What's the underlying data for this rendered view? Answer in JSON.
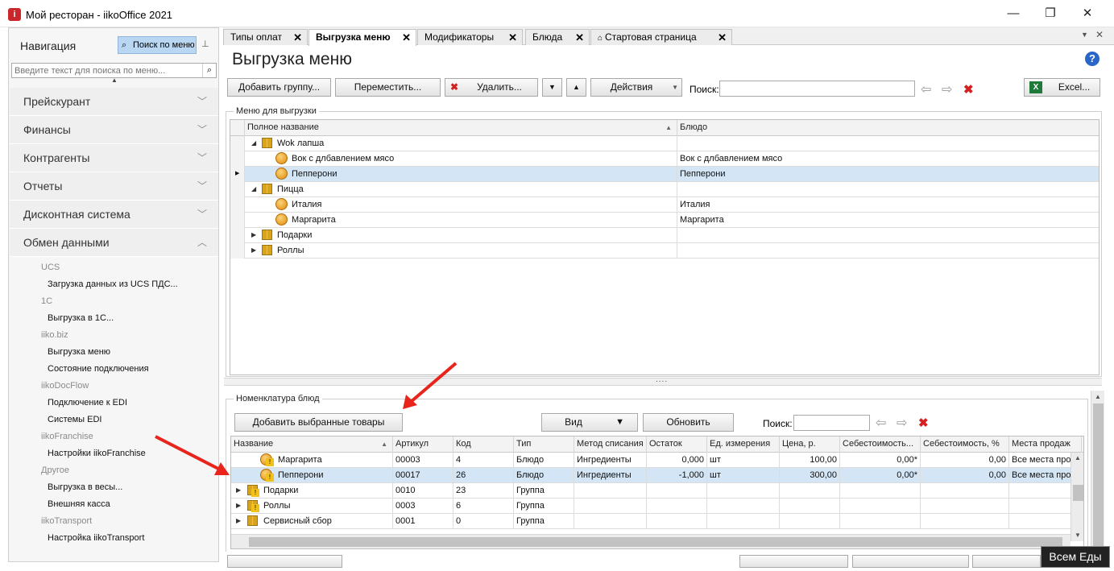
{
  "window": {
    "title": "Мой ресторан - iikoOffice 2021",
    "app_icon": "iiko-app-icon",
    "minimize_glyph": "—",
    "maximize_glyph": "❐",
    "close_glyph": "✕"
  },
  "nav": {
    "title": "Навигация",
    "search_button": "Поиск по меню",
    "search_placeholder": "Введите текст для поиска по меню...",
    "categories": [
      {
        "label": "Прейскурант",
        "expanded": false
      },
      {
        "label": "Финансы",
        "expanded": false
      },
      {
        "label": "Контрагенты",
        "expanded": false
      },
      {
        "label": "Отчеты",
        "expanded": false
      },
      {
        "label": "Дисконтная система",
        "expanded": false
      },
      {
        "label": "Обмен данными",
        "expanded": true
      }
    ],
    "items": [
      {
        "group": "UCS"
      },
      {
        "label": "Загрузка данных из UCS ПДС..."
      },
      {
        "group": "1C"
      },
      {
        "label": "Выгрузка в 1С..."
      },
      {
        "group": "iiko.biz"
      },
      {
        "label": "Выгрузка меню"
      },
      {
        "label": "Состояние подключения"
      },
      {
        "group": "iikoDocFlow"
      },
      {
        "label": "Подключение к EDI"
      },
      {
        "label": "Системы EDI"
      },
      {
        "group": "iikoFranchise"
      },
      {
        "label": "Настройки iikoFranchise"
      },
      {
        "group": "Другое"
      },
      {
        "label": "Выгрузка в весы..."
      },
      {
        "label": "Внешняя касса"
      },
      {
        "group": "iikoTransport"
      },
      {
        "label": "Настройка iikoTransport"
      }
    ]
  },
  "tabs": [
    {
      "label": "Типы оплат",
      "active": false
    },
    {
      "label": "Выгрузка меню",
      "active": true
    },
    {
      "label": "Модификаторы",
      "active": false
    },
    {
      "label": "Блюда",
      "active": false
    },
    {
      "label": "Стартовая страница",
      "active": false
    }
  ],
  "page": {
    "title": "Выгрузка меню"
  },
  "toolbar": {
    "add_group": "Добавить группу...",
    "move": "Переместить...",
    "delete": "Удалить...",
    "actions": "Действия",
    "search_label": "Поиск:",
    "excel": "Excel..."
  },
  "menu_panel": {
    "title": "Меню для выгрузки",
    "columns": [
      "Полное название",
      "Блюдо"
    ],
    "rows": [
      {
        "level": 0,
        "type": "group",
        "expanded": true,
        "name": "Wok лапша",
        "dish": "",
        "selected": false
      },
      {
        "level": 1,
        "type": "dish",
        "name": "Вок с длбавлением мясо",
        "dish": "Вок с длбавлением мясо",
        "selected": false
      },
      {
        "level": 1,
        "type": "dish",
        "name": "Пепперони",
        "dish": "Пепперони",
        "selected": true
      },
      {
        "level": 0,
        "type": "group",
        "expanded": true,
        "name": "Пицца",
        "dish": "",
        "selected": false
      },
      {
        "level": 1,
        "type": "dish",
        "name": "Италия",
        "dish": "Италия",
        "selected": false
      },
      {
        "level": 1,
        "type": "dish",
        "name": "Маргарита",
        "dish": "Маргарита",
        "selected": false
      },
      {
        "level": 0,
        "type": "group",
        "expanded": false,
        "name": "Подарки",
        "dish": "",
        "selected": false
      },
      {
        "level": 0,
        "type": "group",
        "expanded": false,
        "name": "Роллы",
        "dish": "",
        "selected": false
      }
    ]
  },
  "splitter": "....",
  "nomenclature": {
    "title": "Номенклатура блюд",
    "add_selected": "Добавить выбранные товары",
    "view": "Вид",
    "refresh": "Обновить",
    "search_label": "Поиск:",
    "columns": [
      "Название",
      "Артикул",
      "Код",
      "Тип",
      "Метод списания",
      "Остаток",
      "Ед. измерения",
      "Цена, р.",
      "Себестоимость...",
      "Себестоимость, %",
      "Места продаж"
    ],
    "rows": [
      {
        "icon": "dish",
        "warn": true,
        "name": "Маргарита",
        "article": "00003",
        "code": "4",
        "type": "Блюдо",
        "method": "Ингредиенты",
        "rest": "0,000",
        "unit": "шт",
        "price": "100,00",
        "cost": "0,00*",
        "cost_pct": "0,00",
        "places": "Все места про...",
        "selected": false
      },
      {
        "icon": "dish",
        "warn": true,
        "name": "Пепперони",
        "article": "00017",
        "code": "26",
        "type": "Блюдо",
        "method": "Ингредиенты",
        "rest": "-1,000",
        "unit": "шт",
        "price": "300,00",
        "cost": "0,00*",
        "cost_pct": "0,00",
        "places": "Все места про...",
        "selected": true
      },
      {
        "icon": "folder",
        "warn": true,
        "name": "Подарки",
        "article": "0010",
        "code": "23",
        "type": "Группа",
        "method": "",
        "rest": "",
        "unit": "",
        "price": "",
        "cost": "",
        "cost_pct": "",
        "places": "",
        "selected": false
      },
      {
        "icon": "folder",
        "warn": true,
        "name": "Роллы",
        "article": "0003",
        "code": "6",
        "type": "Группа",
        "method": "",
        "rest": "",
        "unit": "",
        "price": "",
        "cost": "",
        "cost_pct": "",
        "places": "",
        "selected": false
      },
      {
        "icon": "folder",
        "warn": false,
        "name": "Сервисный сбор",
        "article": "0001",
        "code": "0",
        "type": "Группа",
        "method": "",
        "rest": "",
        "unit": "",
        "price": "",
        "cost": "",
        "cost_pct": "",
        "places": "",
        "selected": false
      }
    ]
  },
  "tooltip": "Всем Еды",
  "colors": {
    "accent": "#b9d7f3",
    "selection": "#d4e6f6",
    "arrow": "#e8241c"
  }
}
